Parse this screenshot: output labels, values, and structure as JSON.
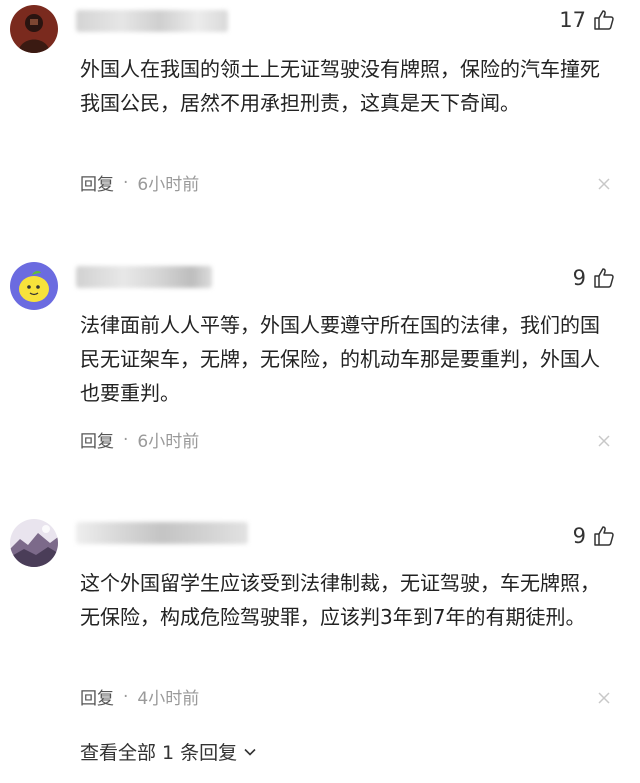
{
  "comments": [
    {
      "likes": "17",
      "text": "外国人在我国的领土上无证驾驶没有牌照，保险的汽车撞死我国公民，居然不用承担刑责，这真是天下奇闻。",
      "reply_label": "回复",
      "separator": "·",
      "time": "6小时前",
      "avatar_icon": "dark-red-portrait-avatar"
    },
    {
      "likes": "9",
      "text": "法律面前人人平等，外国人要遵守所在国的法律，我们的国民无证架车，无牌，无保险，的机动车那是要重判，外国人也要重判。",
      "reply_label": "回复",
      "separator": "·",
      "time": "6小时前",
      "avatar_icon": "lemon-cartoon-avatar"
    },
    {
      "likes": "9",
      "text": "这个外国留学生应该受到法律制裁，无证驾驶，车无牌照，无保险，构成危险驾驶罪，应该判3年到7年的有期徒刑。",
      "reply_label": "回复",
      "separator": "·",
      "time": "4小时前",
      "avatar_icon": "landscape-photo-avatar"
    }
  ],
  "view_replies": {
    "label": "查看全部 1 条回复"
  },
  "icons": {
    "like": "thumbs-up-icon",
    "close": "close-icon",
    "expand": "chevron-down-icon"
  },
  "colors": {
    "text": "#222222",
    "meta": "#9a9a9a",
    "reply": "#555555"
  }
}
